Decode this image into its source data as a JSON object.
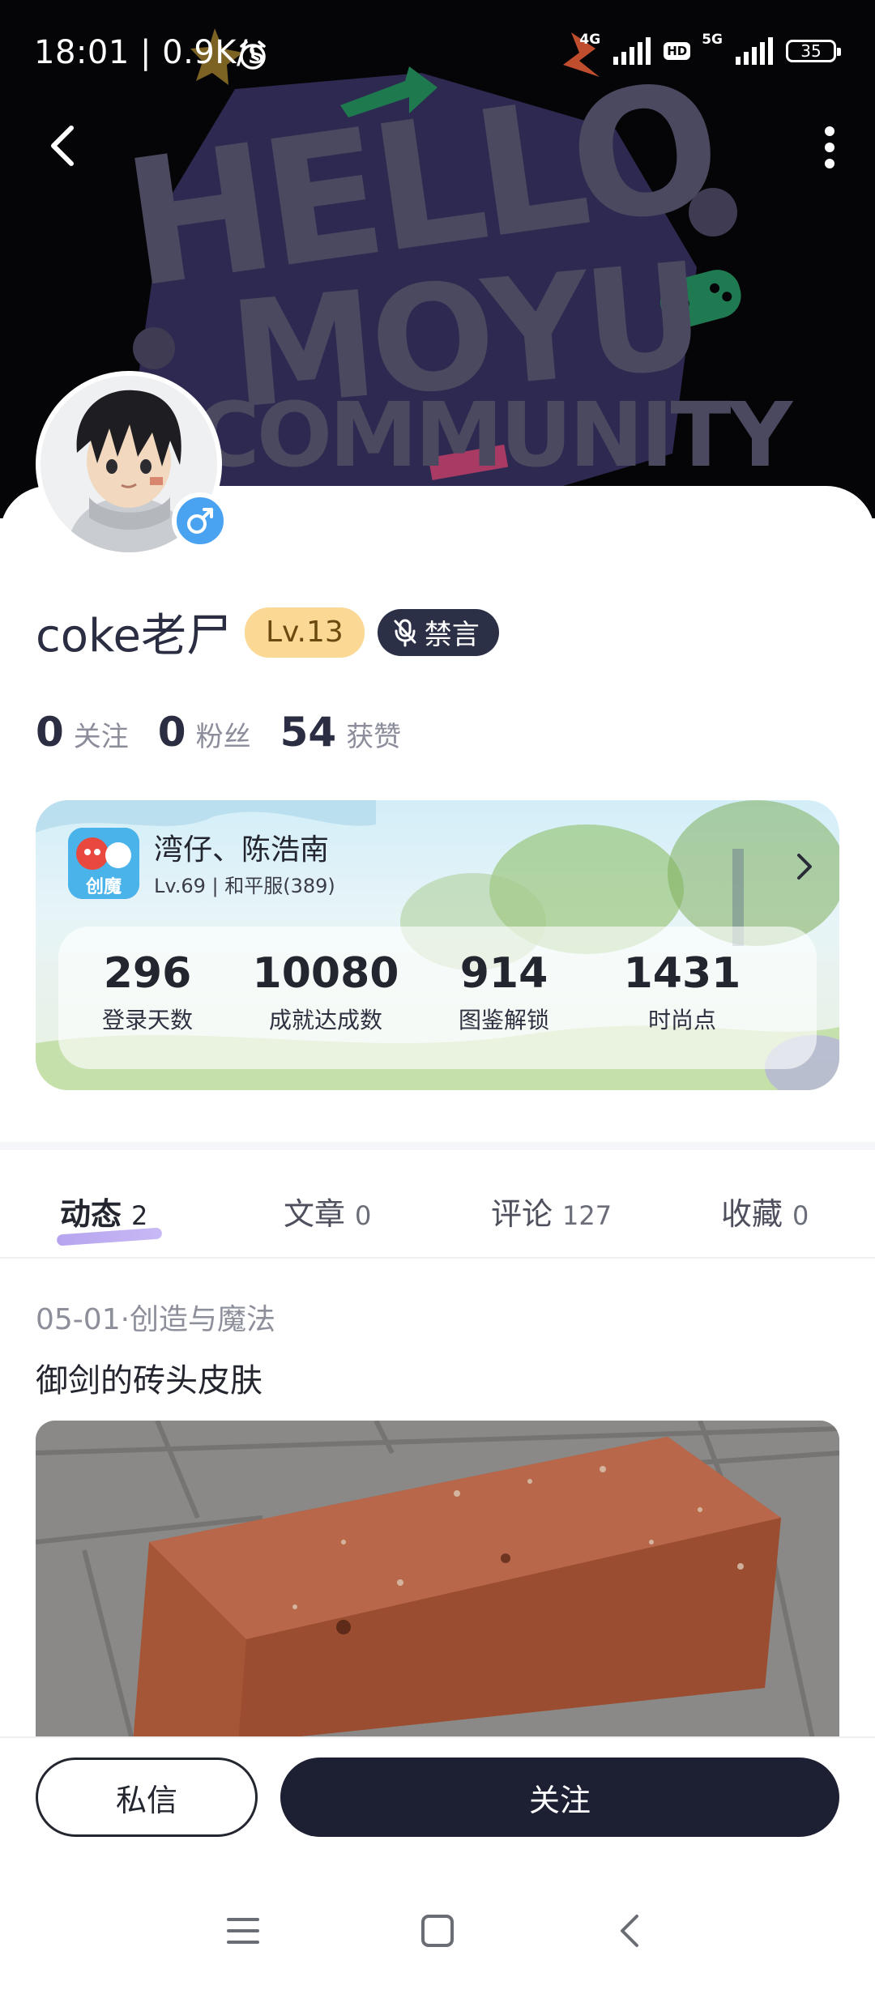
{
  "status_bar": {
    "time_speed": "18:01 | 0.9K/s",
    "net_4g": "4G",
    "hd": "HD",
    "net_5g": "5G",
    "battery": "35"
  },
  "banner": {
    "art_text_line1": "HELLO",
    "art_text_line2": "MOYU",
    "art_text_line3": "COMMUNITY"
  },
  "profile": {
    "username": "coke老尸",
    "level": "Lv.13",
    "mute_label": "禁言",
    "stats": [
      {
        "value": "0",
        "label": "关注"
      },
      {
        "value": "0",
        "label": "粉丝"
      },
      {
        "value": "54",
        "label": "获赞"
      }
    ]
  },
  "game_card": {
    "icon_text": "创魔",
    "name": "湾仔、陈浩南",
    "sub": "Lv.69 | 和平服(389)",
    "stats": [
      {
        "value": "296",
        "label": "登录天数"
      },
      {
        "value": "10080",
        "label": "成就达成数"
      },
      {
        "value": "914",
        "label": "图鉴解锁"
      },
      {
        "value": "1431",
        "label": "时尚点"
      }
    ]
  },
  "tabs": [
    {
      "label": "动态",
      "count": "2"
    },
    {
      "label": "文章",
      "count": "0"
    },
    {
      "label": "评论",
      "count": "127"
    },
    {
      "label": "收藏",
      "count": "0"
    }
  ],
  "post": {
    "meta": "05-01·创造与魔法",
    "title": "御剑的砖头皮肤"
  },
  "actions": {
    "dm_label": "私信",
    "follow_label": "关注"
  },
  "colors": {
    "accent_dark": "#1d1f33",
    "level_badge": "#fbd894",
    "gender_blue": "#4aa3f0",
    "tab_underline": "#b6a4ef"
  },
  "icons": [
    "back-arrow-icon",
    "more-vertical-icon",
    "alarm-icon",
    "signal-icon",
    "battery-icon",
    "male-icon",
    "mute-mic-icon",
    "chevron-right-icon",
    "menu-icon",
    "home-square-icon",
    "back-chevron-icon"
  ]
}
